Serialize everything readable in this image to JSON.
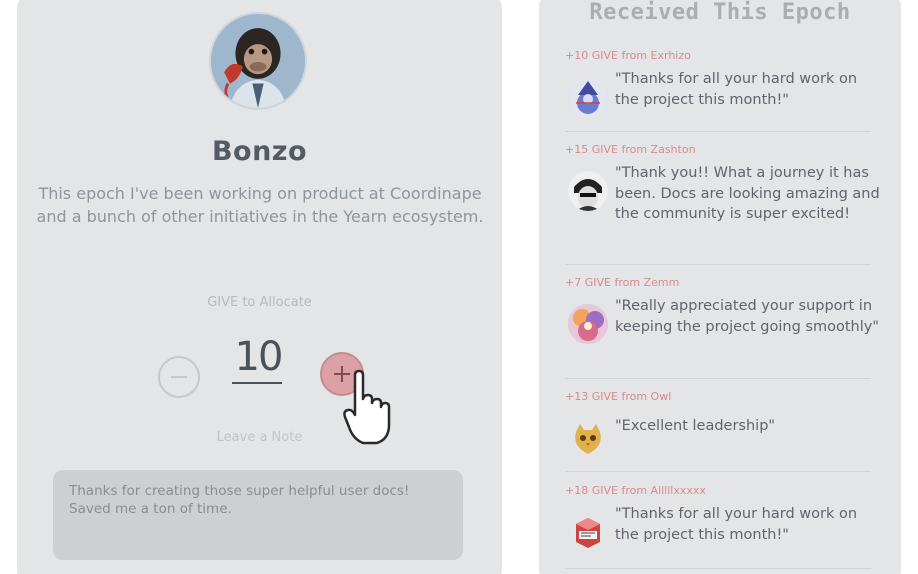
{
  "profile": {
    "name": "Bonzo",
    "bio": "This epoch I've been working on product at Coordinape and a bunch of other initiatives in the Yearn ecosystem.",
    "give_label": "GIVE to Allocate",
    "give_amount": "10",
    "note_label": "Leave a Note",
    "note_text": "Thanks for creating those super helpful user docs! Saved me a ton of time."
  },
  "received": {
    "title": "Received This Epoch",
    "gifts": [
      {
        "header": "+10 GIVE from Exrhizo",
        "message": "\"Thanks for all your hard work on the project this month!\"",
        "avatar": "wizard-avatar"
      },
      {
        "header": "+15 GIVE from Zashton",
        "message": "\"Thank you!! What a journey it has been. Docs are looking amazing and the community is super excited!",
        "avatar": "bw-portrait-avatar"
      },
      {
        "header": "+7 GIVE from Zemm",
        "message": "\"Really appreciated your support in keeping the project going smoothly\"",
        "avatar": "colorful-avatar"
      },
      {
        "header": "+13 GIVE from Owl",
        "message": "\"Excellent leadership\"",
        "avatar": "owl-avatar"
      },
      {
        "header": "+18 GIVE from Alllllxxxxx",
        "message": "\"Thanks for all your hard work on the project this month!\"",
        "avatar": "cube-avatar"
      }
    ]
  },
  "colors": {
    "card_bg": "#e3e5e7",
    "accent_pink": "#d98a8e",
    "plus_button": "#dba1a6"
  }
}
